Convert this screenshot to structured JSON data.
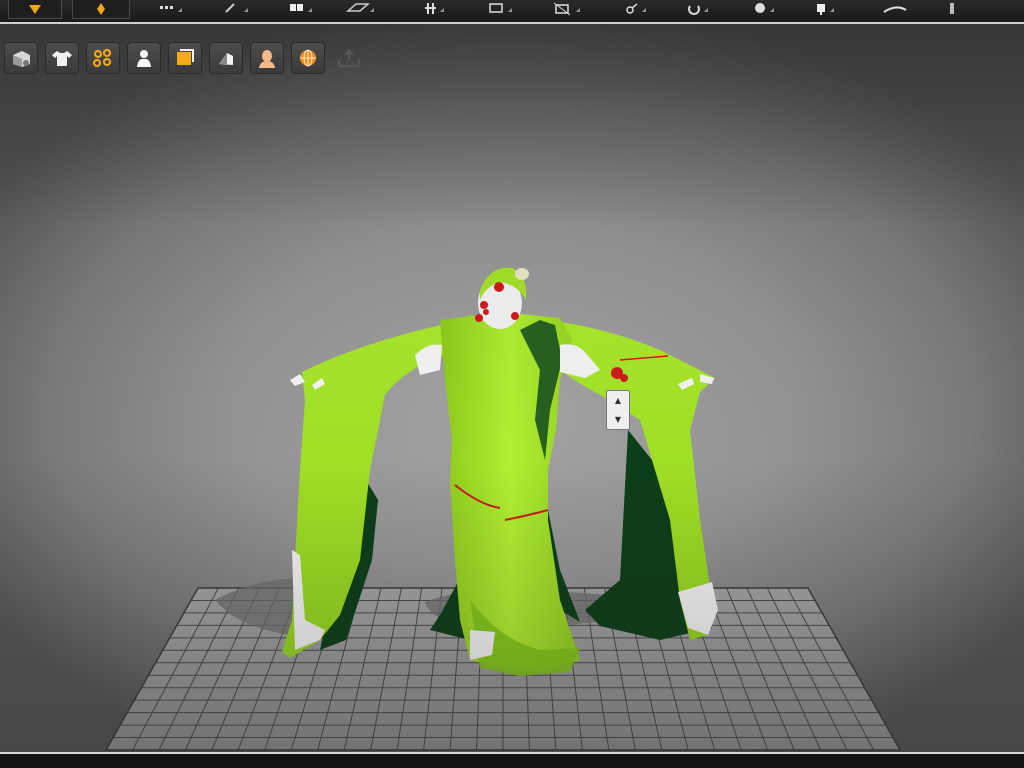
{
  "app": {
    "top_toolbar_icons": [
      "marker-icon",
      "pin-icon",
      "dots-icon",
      "arrow-icon",
      "grid-icon",
      "shape-icon",
      "tree-icon",
      "box-icon",
      "transform-icon",
      "link-icon",
      "rotate-icon",
      "circle-icon",
      "figure-icon",
      "curve-icon",
      "tip-icon"
    ]
  },
  "viewport_toolbar": {
    "buttons": [
      {
        "name": "solid-view-button",
        "icon": "cube-icon"
      },
      {
        "name": "garment-view-button",
        "icon": "shirt-icon"
      },
      {
        "name": "particle-view-button",
        "icon": "mesh-points-icon"
      },
      {
        "name": "avatar-view-button",
        "icon": "avatar-icon"
      },
      {
        "name": "texture-view-button",
        "icon": "fabric-icon"
      },
      {
        "name": "shadow-view-button",
        "icon": "shade-icon"
      },
      {
        "name": "skin-view-button",
        "icon": "head-icon"
      },
      {
        "name": "pressure-map-button",
        "icon": "globe-map-icon"
      },
      {
        "name": "export-button",
        "icon": "upload-tray-icon"
      }
    ]
  },
  "colors": {
    "garment": "#a6e22a",
    "garment_dark": "#0c3d18",
    "pin_marker": "#d01a1a",
    "avatar": "#f3f3f3",
    "grid_line": "#4a4a4a",
    "grid_floor": "#9a9a9a"
  },
  "spinner": {
    "up": "▲",
    "down": "▼"
  }
}
